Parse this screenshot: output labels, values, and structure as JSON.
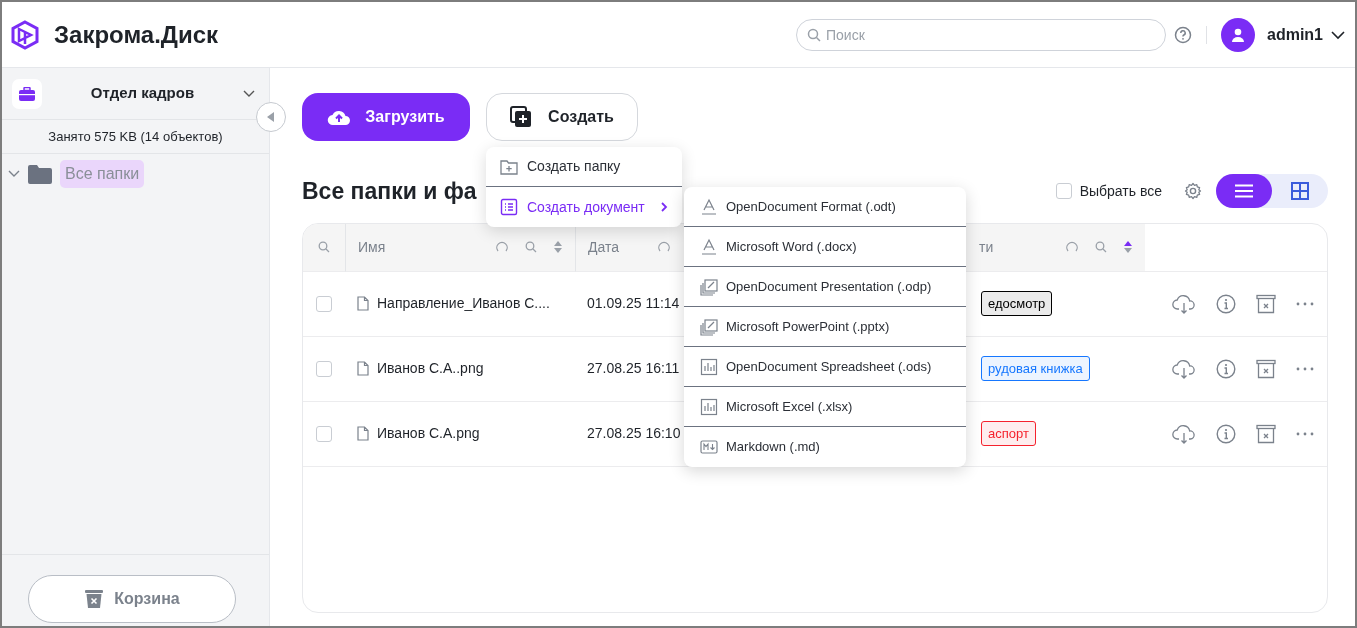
{
  "header": {
    "brand": "Закрома.Диск",
    "search": {
      "placeholder": "Поиск"
    },
    "user": "admin1"
  },
  "sidebar": {
    "department": "Отдел кадров",
    "usage": "Занято 575 KB (14 объектов)",
    "tree": [
      {
        "label": "Все папки",
        "expanded": true,
        "selected": true
      }
    ],
    "trash_button": "Корзина"
  },
  "toolbar": {
    "upload_button": "Загрузить",
    "create_button": "Создать"
  },
  "title": "Все папки и фа",
  "select_all": {
    "label": "Выбрать все",
    "checked": false
  },
  "view_toggle": [
    {
      "kind": "list",
      "selected": true
    },
    {
      "kind": "grid",
      "selected": false
    }
  ],
  "table": {
    "columns": [
      {
        "label": "Имя",
        "sorted": false
      },
      {
        "label": "Дата"
      },
      {
        "label": "ти",
        "sorted": true
      }
    ],
    "rows": [
      {
        "checked": false,
        "name": "Направление_Иванов С....",
        "date": "01.09.25 11:14",
        "tag": {
          "text": "едосмотр",
          "color": "#000000"
        }
      },
      {
        "checked": false,
        "name": "Иванов С.А..png",
        "date": "27.08.25 16:11",
        "tag": {
          "text": "рудовая книжка",
          "color": "#1677ff"
        }
      },
      {
        "checked": false,
        "name": "Иванов С.А.png",
        "date": "27.08.25 16:10",
        "tag": {
          "text": "аспорт",
          "color": "#f5222d"
        }
      }
    ]
  },
  "create_menu": [
    {
      "kind": "folder",
      "label": "Создать папку",
      "selected": false
    },
    {
      "kind": "document",
      "label": "Создать документ",
      "selected": true
    }
  ],
  "document_menu": [
    {
      "kind": "text",
      "label": "OpenDocument Format (.odt)"
    },
    {
      "kind": "text",
      "label": "Microsoft Word (.docx)"
    },
    {
      "kind": "presentation",
      "label": "OpenDocument Presentation (.odp)"
    },
    {
      "kind": "presentation",
      "label": "Microsoft PowerPoint (.pptx)"
    },
    {
      "kind": "spreadsheet",
      "label": "OpenDocument Spreadsheet (.ods)"
    },
    {
      "kind": "spreadsheet",
      "label": "Microsoft Excel (.xlsx)"
    },
    {
      "kind": "markdown",
      "label": "Markdown (.md)"
    }
  ]
}
